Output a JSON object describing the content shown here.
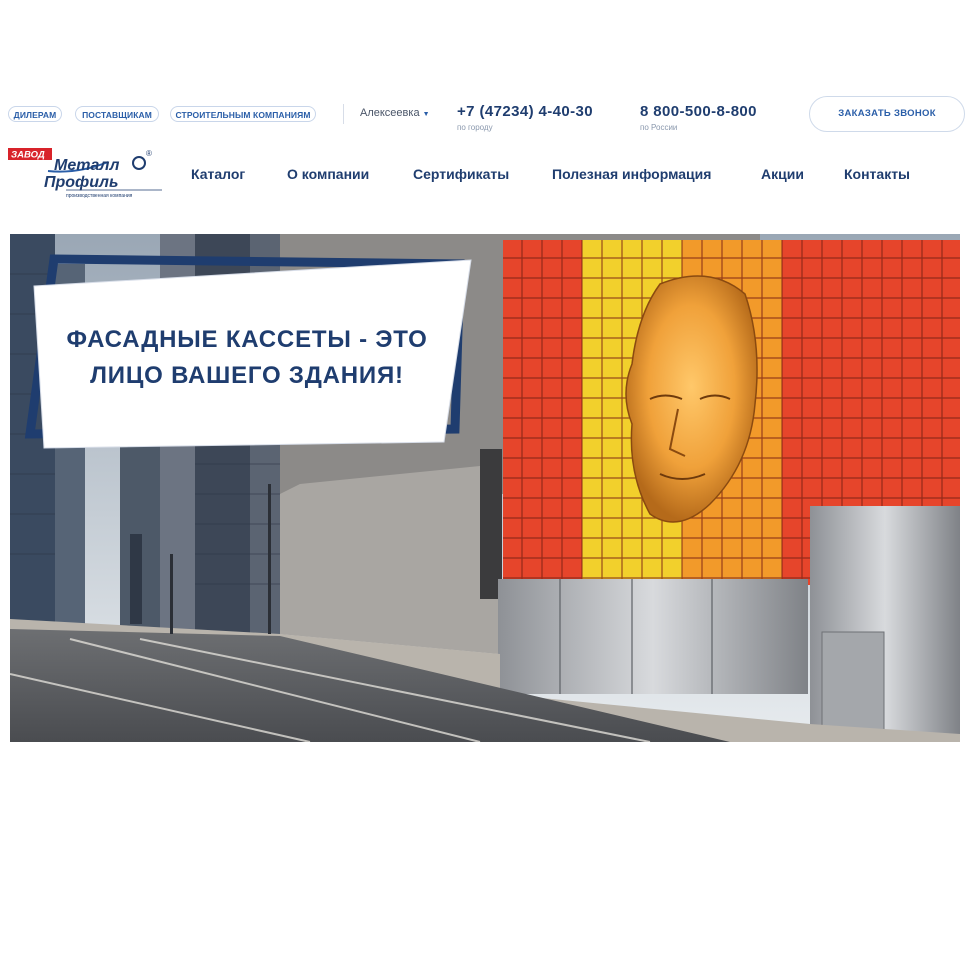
{
  "header": {
    "tags": [
      "ДИЛЕРАМ",
      "ПОСТАВЩИКАМ",
      "СТРОИТЕЛЬНЫМ КОМПАНИЯМ"
    ],
    "city": "Алексеевка",
    "phone_city": "+7 (47234) 4-40-30",
    "phone_city_note": "по городу",
    "phone_russia": "8 800-500-8-800",
    "phone_russia_note": "по России",
    "callback_label": "ЗАКАЗАТЬ ЗВОНОК"
  },
  "logo": {
    "badge": "ЗАВОД",
    "line1": "Металл",
    "line2": "Профиль",
    "tagline": "производственная компания",
    "mark": "®"
  },
  "nav": {
    "items": [
      "Каталог",
      "О компании",
      "Сертификаты",
      "Полезная информация",
      "Акции",
      "Контакты"
    ]
  },
  "hero": {
    "title_line1": "ФАСАДНЫЕ КАССЕТЫ - ЭТО",
    "title_line2": "ЛИЦО ВАШЕГО ЗДАНИЯ!"
  },
  "colors": {
    "brand_blue": "#1f3d6f",
    "accent_blue": "#2a5ea8",
    "logo_red": "#d8232a",
    "facade_red": "#e6452b",
    "facade_yellow": "#f2d02c",
    "facade_orange": "#f29a2a"
  }
}
